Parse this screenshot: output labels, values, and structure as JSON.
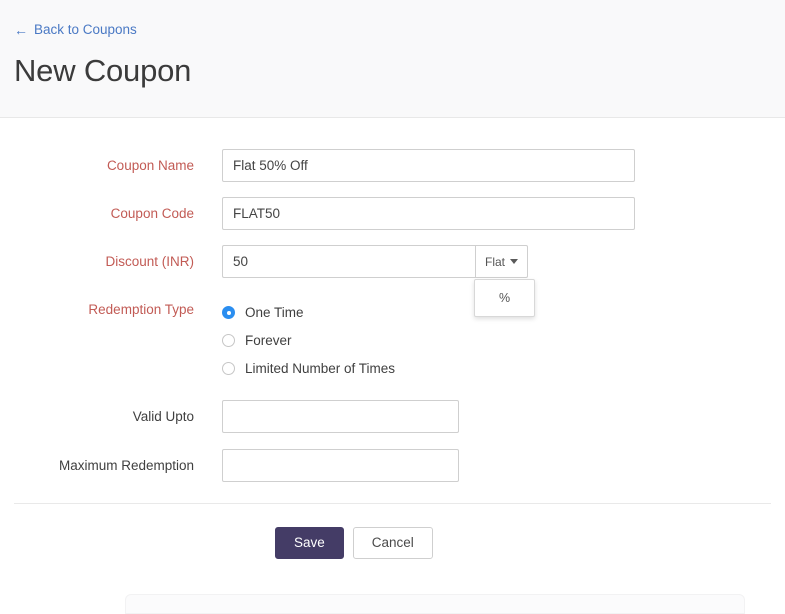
{
  "header": {
    "back_link": "Back to Coupons",
    "back_arrow_icon": "arrow-left-icon",
    "title": "New Coupon"
  },
  "form": {
    "coupon_name": {
      "label": "Coupon Name",
      "value": "Flat 50% Off",
      "placeholder": ""
    },
    "coupon_code": {
      "label": "Coupon Code",
      "value": "FLAT50",
      "placeholder": ""
    },
    "discount": {
      "label": "Discount  (INR)",
      "value": "50",
      "placeholder": "",
      "unit_selected": "Flat",
      "unit_caret_icon": "chevron-down-icon",
      "unit_options": [
        "%"
      ]
    },
    "redemption_type": {
      "label": "Redemption Type",
      "selected": "One Time",
      "options": [
        {
          "label": "One Time",
          "checked": true
        },
        {
          "label": "Forever",
          "checked": false
        },
        {
          "label": "Limited Number of Times",
          "checked": false
        }
      ]
    },
    "valid_upto": {
      "label": "Valid Upto",
      "value": "",
      "placeholder": ""
    },
    "maximum_redemption": {
      "label": "Maximum Redemption",
      "value": "",
      "placeholder": ""
    }
  },
  "footer": {
    "save_label": "Save",
    "cancel_label": "Cancel"
  },
  "colors": {
    "required_label": "#c25b55",
    "link": "#4a79c4",
    "primary_button": "#443c66",
    "radio_selected": "#2b8ef0",
    "header_background": "#f9f9fa"
  }
}
